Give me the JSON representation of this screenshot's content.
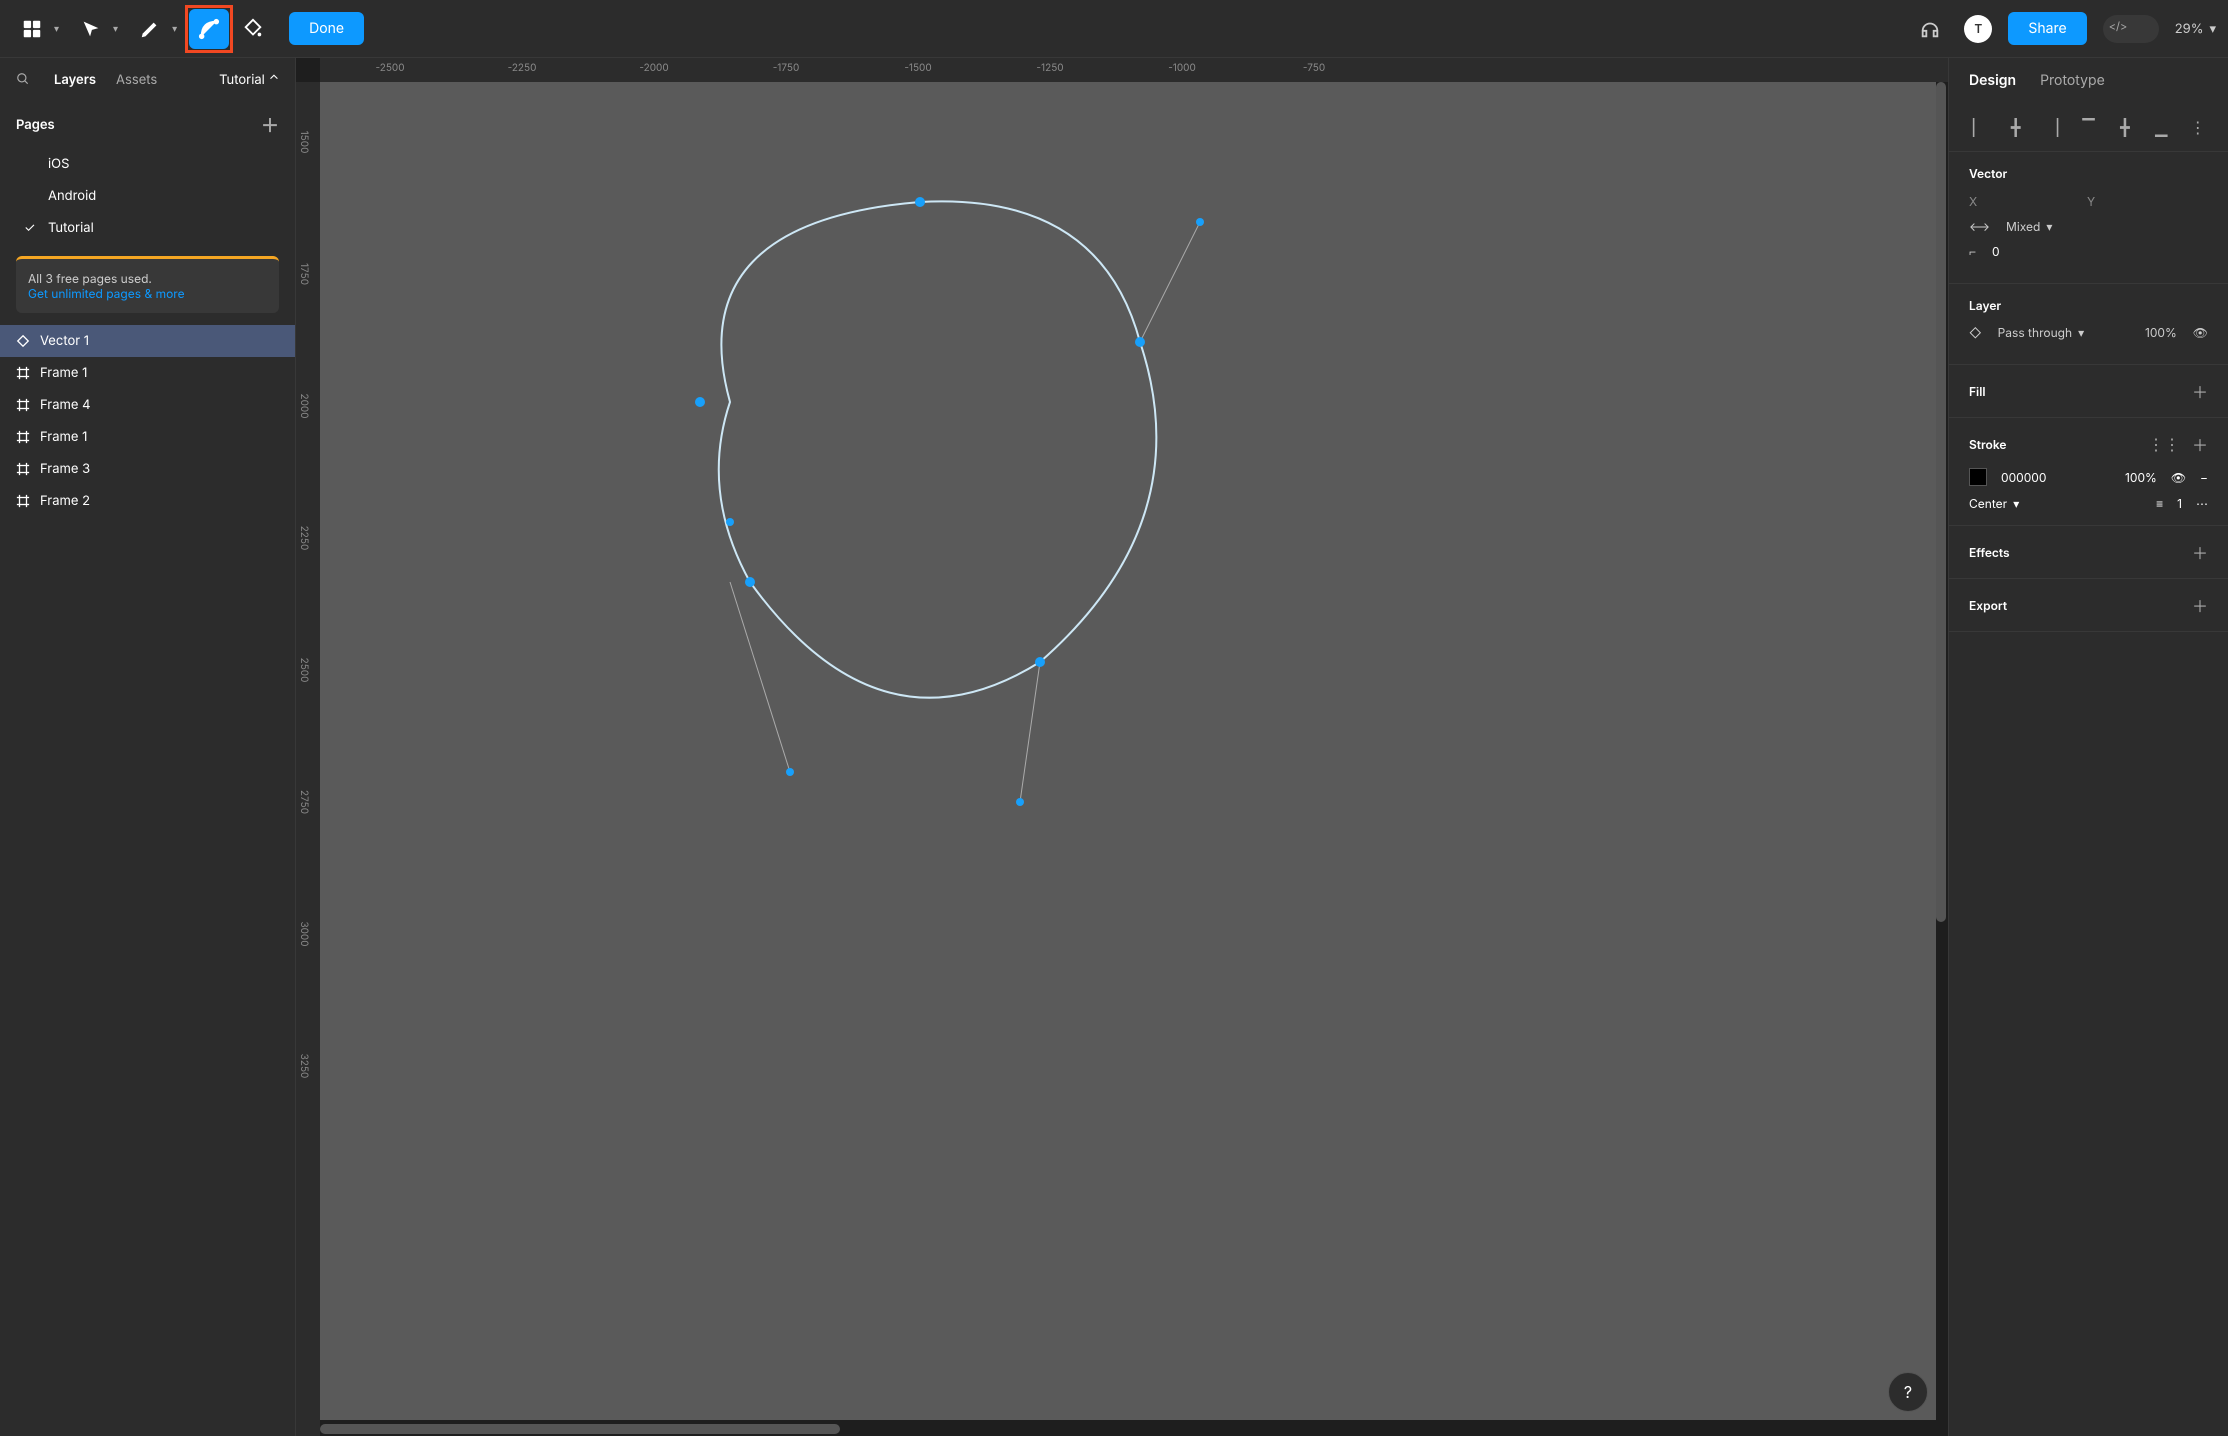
{
  "toolbar": {
    "done_label": "Done",
    "share_label": "Share",
    "avatar_initials": "T",
    "zoom": "29%"
  },
  "left_panel": {
    "tabs": {
      "layers": "Layers",
      "assets": "Assets"
    },
    "file_name": "Tutorial",
    "pages_label": "Pages",
    "pages": [
      "iOS",
      "Android",
      "Tutorial"
    ],
    "selected_page_index": 2,
    "upgrade": {
      "line1": "All 3 free pages used.",
      "link": "Get unlimited pages & more"
    },
    "layers": [
      {
        "name": "Vector 1",
        "icon": "vector",
        "selected": true
      },
      {
        "name": "Frame 1",
        "icon": "frame"
      },
      {
        "name": "Frame 4",
        "icon": "frame"
      },
      {
        "name": "Frame 1",
        "icon": "frame"
      },
      {
        "name": "Frame 3",
        "icon": "frame"
      },
      {
        "name": "Frame 2",
        "icon": "frame"
      }
    ]
  },
  "ruler": {
    "h": [
      "-2500",
      "-2250",
      "-2000",
      "-1750",
      "-1500",
      "-1250",
      "-1000",
      "-750"
    ],
    "v": [
      "1500",
      "1750",
      "2000",
      "2250",
      "2500",
      "2750",
      "3000",
      "3250"
    ]
  },
  "right_panel": {
    "tabs": {
      "design": "Design",
      "prototype": "Prototype"
    },
    "vector": {
      "title": "Vector",
      "x_label": "X",
      "y_label": "Y",
      "constraint": "Mixed",
      "corner_radius": "0"
    },
    "layer": {
      "title": "Layer",
      "blend_mode": "Pass through",
      "opacity": "100%"
    },
    "fill": {
      "title": "Fill"
    },
    "stroke": {
      "title": "Stroke",
      "color_hex": "000000",
      "opacity": "100%",
      "position": "Center",
      "weight": "1"
    },
    "effects": {
      "title": "Effects"
    },
    "export": {
      "title": "Export"
    }
  }
}
